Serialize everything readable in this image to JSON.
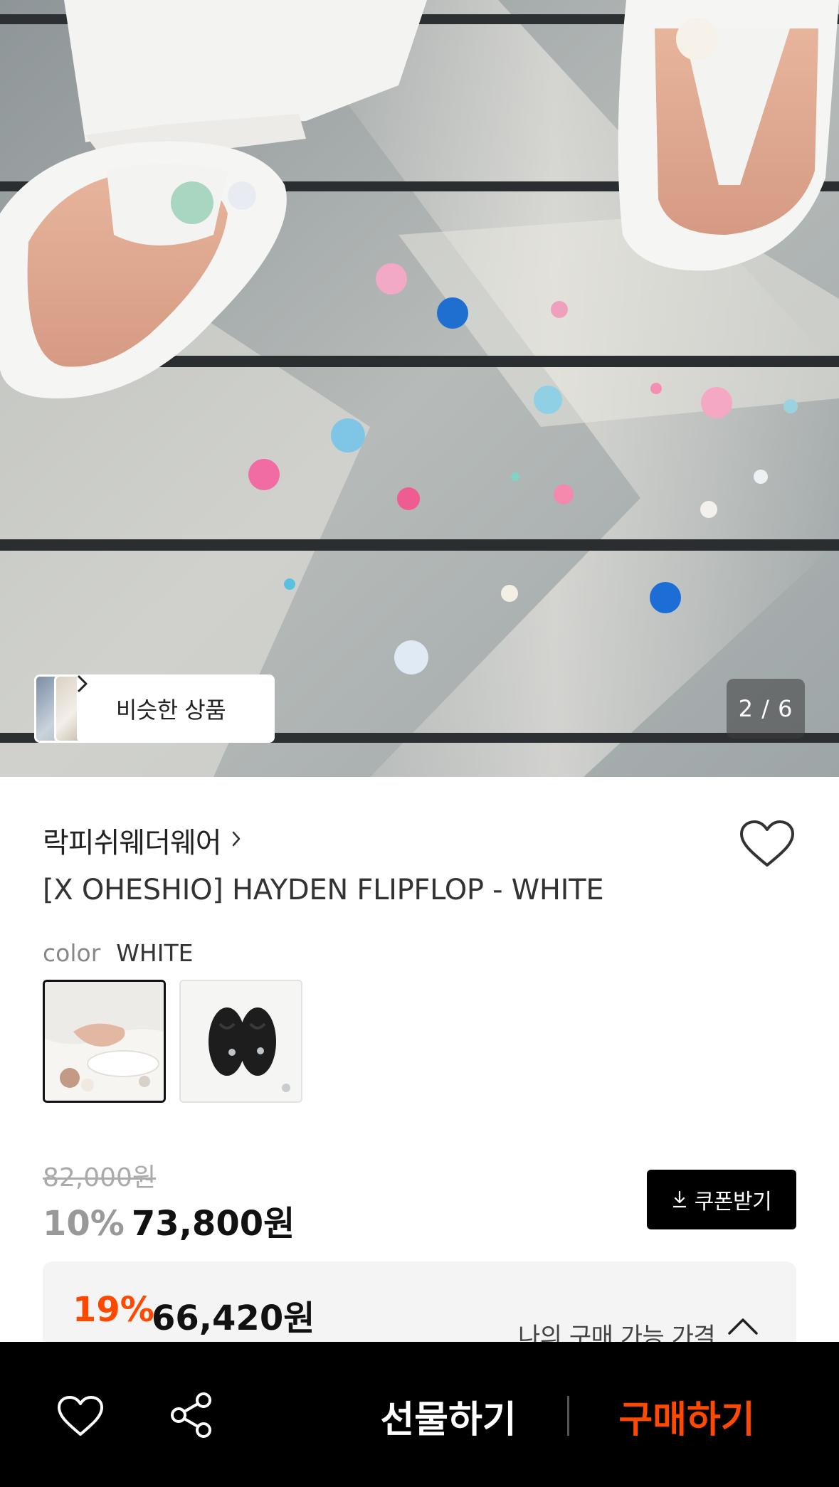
{
  "gallery": {
    "similar_label": "비슷한 상품",
    "pager_text": "2 / 6"
  },
  "product": {
    "brand": "락피쉬웨더웨어",
    "title": "[X OHESHIO] HAYDEN FLIPFLOP - WHITE",
    "color_label": "color",
    "color_value": "WHITE"
  },
  "price": {
    "original": "82,000원",
    "discount_rate": "10%",
    "sale": "73,800원",
    "coupon_label": "쿠폰받기",
    "my_rate": "19%",
    "my_price": "66,420원",
    "my_label": "나의 구매 가능 가격"
  },
  "bottom_bar": {
    "gift_label": "선물하기",
    "buy_label": "구매하기"
  },
  "colors": {
    "accent": "#ff4800",
    "bar_bg": "#000000"
  }
}
